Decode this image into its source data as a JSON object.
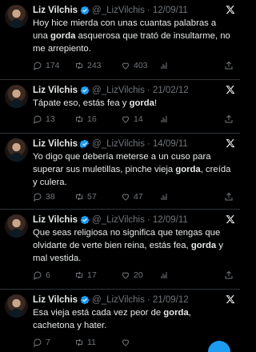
{
  "tweets": [
    {
      "name": "Liz Vilchis",
      "handle": "@_LizVilchis",
      "date": "· 12/09/11",
      "text_parts": [
        {
          "t": "Hoy hice mierda con unas cuantas palabras a una ",
          "b": false
        },
        {
          "t": "gorda",
          "b": true
        },
        {
          "t": " asquerosa que trató de insultarme, no me arrepiento.",
          "b": false
        }
      ],
      "replies": "174",
      "retweets": "243",
      "likes": "403"
    },
    {
      "name": "Liz Vilchis",
      "handle": "@_LizVilchis",
      "date": "· 21/02/12",
      "text_parts": [
        {
          "t": "Tápate eso, estás fea y ",
          "b": false
        },
        {
          "t": "gorda",
          "b": true
        },
        {
          "t": "!",
          "b": false
        }
      ],
      "replies": "13",
      "retweets": "16",
      "likes": "14"
    },
    {
      "name": "Liz Vilchis",
      "handle": "@_LizVilchis",
      "date": "· 14/09/11",
      "text_parts": [
        {
          "t": "Yo digo que debería meterse a un cuso para superar sus muletillas, pinche vieja ",
          "b": false
        },
        {
          "t": "gorda",
          "b": true
        },
        {
          "t": ", creída y culera.",
          "b": false
        }
      ],
      "replies": "38",
      "retweets": "57",
      "likes": "47"
    },
    {
      "name": "Liz Vilchis",
      "handle": "@_LizVilchis",
      "date": "· 12/09/11",
      "text_parts": [
        {
          "t": "Que seas religiosa no significa que tengas que olvidarte de verte bien reina, estás fea, ",
          "b": false
        },
        {
          "t": "gorda",
          "b": true
        },
        {
          "t": " y mal vestida.",
          "b": false
        }
      ],
      "replies": "6",
      "retweets": "17",
      "likes": "20"
    },
    {
      "name": "Liz Vilchis",
      "handle": "@_LizVilchis",
      "date": "· 21/09/12",
      "text_parts": [
        {
          "t": "Esa vieja está cada vez peor de ",
          "b": false
        },
        {
          "t": "gorda",
          "b": true
        },
        {
          "t": ", cachetona y hater.",
          "b": false
        }
      ],
      "replies": "7",
      "retweets": "11",
      "likes": ""
    }
  ],
  "icons": {
    "verified_color": "#1d9bf0",
    "muted_color": "#71767b"
  }
}
